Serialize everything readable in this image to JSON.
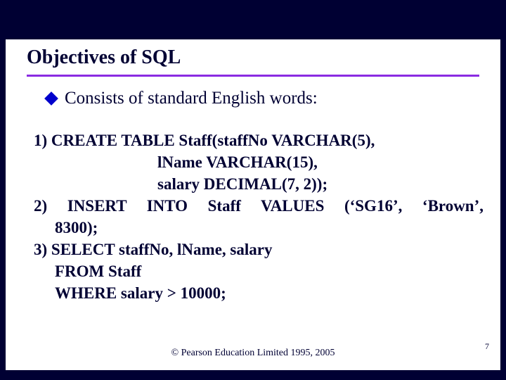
{
  "title": "Objectives of SQL",
  "bullet": "Consists of standard English words:",
  "code": {
    "l1": "1) CREATE TABLE Staff(staffNo VARCHAR(5),",
    "l2": "lName VARCHAR(15),",
    "l3": "salary DECIMAL(7, 2));",
    "l4a": "2)",
    "l4b": "INSERT",
    "l4c": "INTO",
    "l4d": "Staff",
    "l4e": "VALUES",
    "l4f": "(‘SG16’,",
    "l4g": "‘Brown’,",
    "l5": "8300);",
    "l6": "3) SELECT staffNo, lName, salary",
    "l7": "FROM Staff",
    "l8": "WHERE salary > 10000;"
  },
  "footer": "© Pearson Education Limited 1995, 2005",
  "page": "7"
}
